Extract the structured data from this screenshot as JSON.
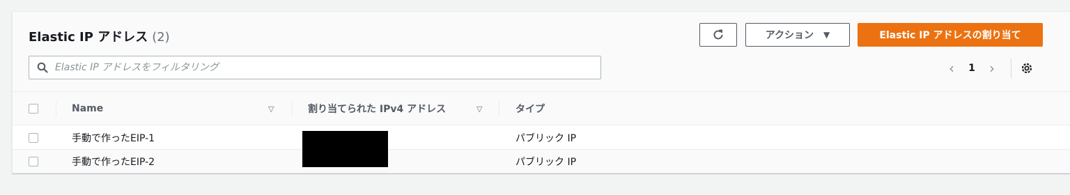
{
  "header": {
    "title": "Elastic IP アドレス",
    "count": "(2)"
  },
  "toolbar": {
    "refresh_icon": "refresh-icon",
    "actions_label": "アクション",
    "allocate_label": "Elastic IP アドレスの割り当て"
  },
  "search": {
    "placeholder": "Elastic IP アドレスをフィルタリング",
    "value": ""
  },
  "pagination": {
    "current_page": "1",
    "prev_icon": "chevron-left-icon",
    "next_icon": "chevron-right-icon",
    "settings_icon": "gear-icon"
  },
  "table": {
    "columns": [
      "Name",
      "割り当てられた IPv4 アドレス",
      "タイプ"
    ],
    "rows": [
      {
        "name": "手動で作ったEIP-1",
        "ipv4": "",
        "type": "パブリック IP"
      },
      {
        "name": "手動で作ったEIP-2",
        "ipv4": "",
        "type": "パブリック IP"
      }
    ]
  },
  "colors": {
    "primary_button": "#ec7211",
    "text": "#16191f",
    "secondary_text": "#545b64",
    "background": "#f2f3f3"
  }
}
